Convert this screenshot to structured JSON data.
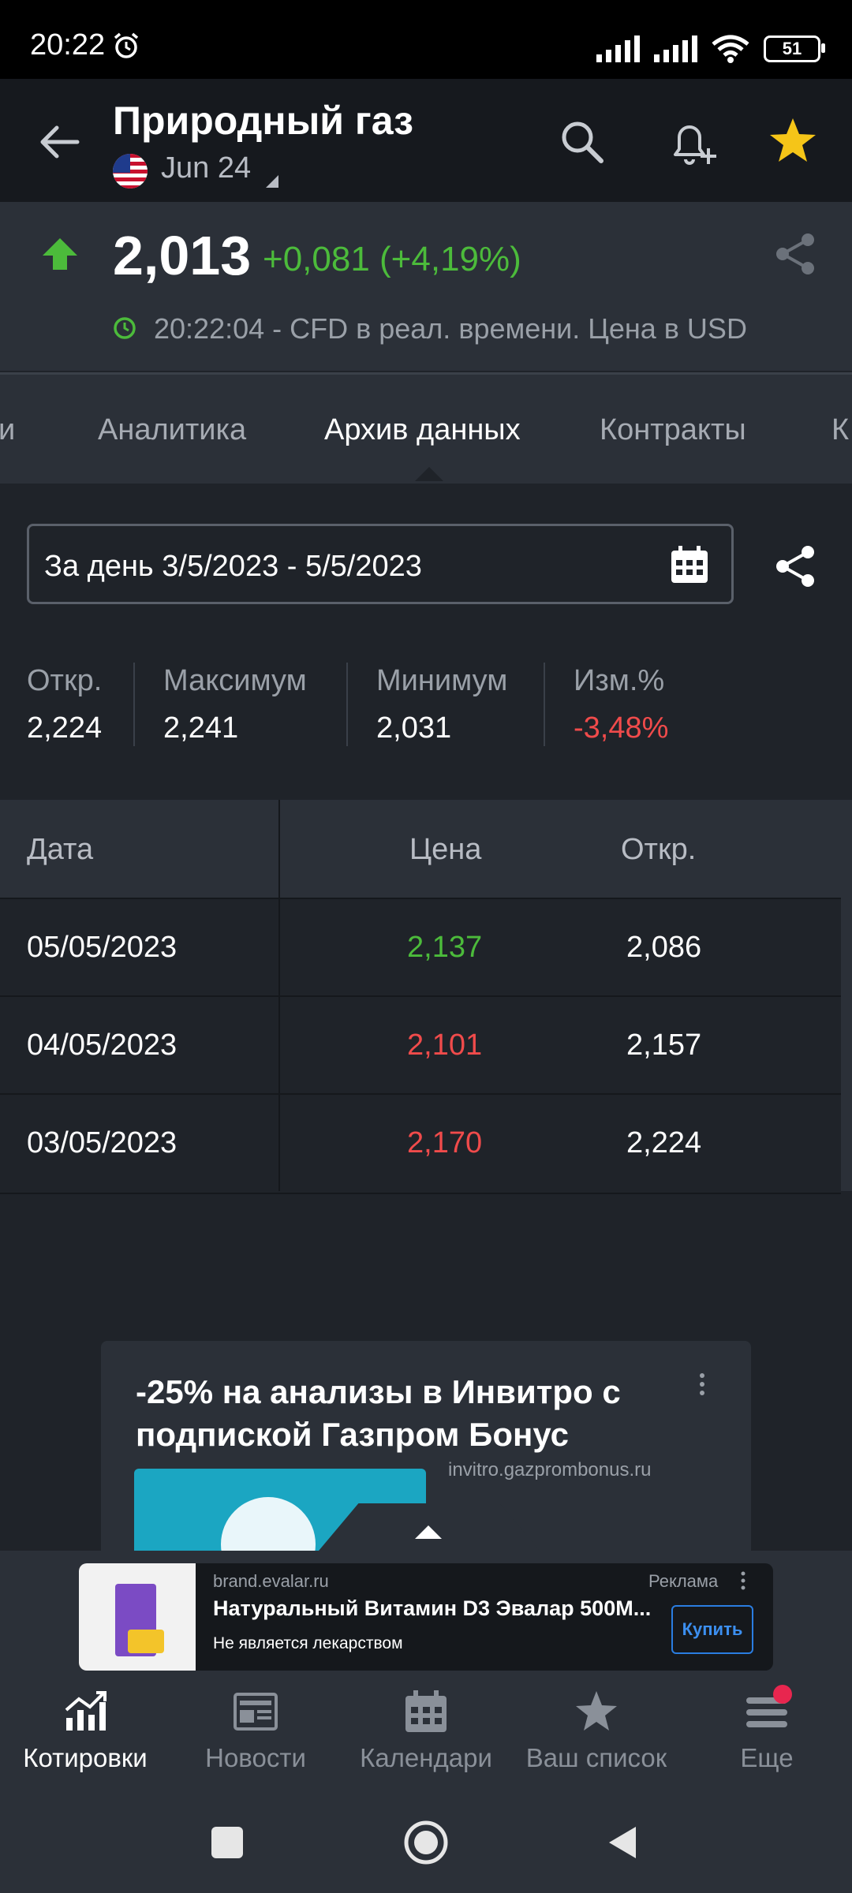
{
  "status_bar": {
    "time": "20:22",
    "battery": "51"
  },
  "header": {
    "title": "Природный газ",
    "contract": "Jun 24"
  },
  "quote": {
    "price": "2,013",
    "change": "+0,081 (+4,19%)",
    "realtime_text": "20:22:04 - CFD в реал. времени. Цена в USD",
    "up_color": "#4cbb3b"
  },
  "tabs": [
    {
      "label": "и"
    },
    {
      "label": "Аналитика"
    },
    {
      "label": "Архив данных"
    },
    {
      "label": "Контракты"
    },
    {
      "label": "К"
    }
  ],
  "date_range": {
    "label": "За день 3/5/2023 - 5/5/2023"
  },
  "stats": [
    {
      "label": "Откр.",
      "value": "2,224"
    },
    {
      "label": "Максимум",
      "value": "2,241"
    },
    {
      "label": "Минимум",
      "value": "2,031"
    },
    {
      "label": "Изм.%",
      "value": "-3,48%"
    }
  ],
  "table": {
    "headers": [
      "Дата",
      "Цена",
      "Откр."
    ],
    "rows": [
      {
        "date": "05/05/2023",
        "price": "2,137",
        "open": "2,086",
        "dir": "up"
      },
      {
        "date": "04/05/2023",
        "price": "2,101",
        "open": "2,157",
        "dir": "down"
      },
      {
        "date": "03/05/2023",
        "price": "2,170",
        "open": "2,224",
        "dir": "down"
      }
    ]
  },
  "colors": {
    "positive": "#4cbb3b",
    "negative": "#f04b4b",
    "accent": "#f5c518"
  },
  "ad_card": {
    "title": "-25% на анализы в Инвитро с подпиской Газпром Бонус",
    "url": "invitro.gazprombonus.ru"
  },
  "banner": {
    "url": "brand.evalar.ru",
    "label": "Реклама",
    "title": "Натуральный Витамин D3 Эвалар 500М...",
    "subtitle": "Не является лекарством",
    "button": "Купить"
  },
  "bottom_nav": [
    {
      "label": "Котировки",
      "icon": "chart-icon"
    },
    {
      "label": "Новости",
      "icon": "news-icon"
    },
    {
      "label": "Календари",
      "icon": "calendar-icon"
    },
    {
      "label": "Ваш список",
      "icon": "star-icon"
    },
    {
      "label": "Еще",
      "icon": "menu-icon"
    }
  ]
}
